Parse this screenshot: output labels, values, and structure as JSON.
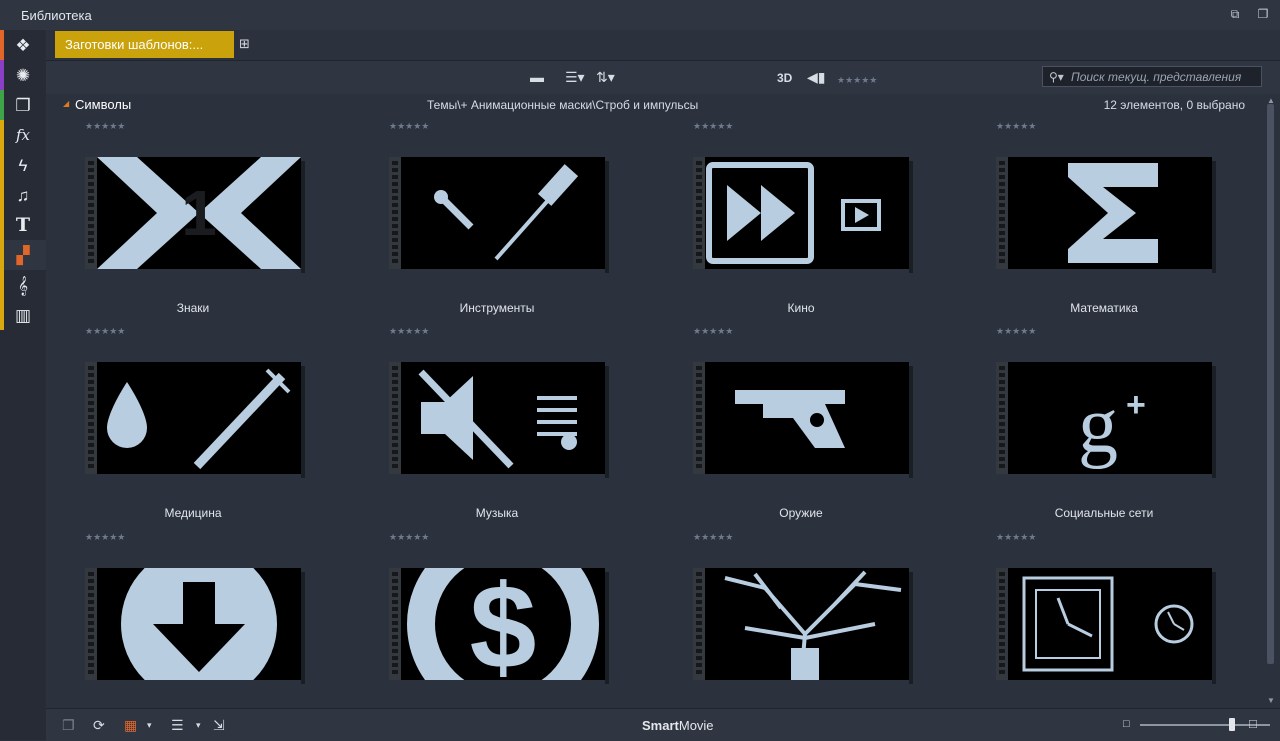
{
  "window": {
    "title": "Библиотека"
  },
  "sidebar": {
    "items": [
      {
        "name": "media-layers-icon",
        "glyph": "❖",
        "color": "#e0662a"
      },
      {
        "name": "film-reel-icon",
        "glyph": "✺",
        "color": "#8b3fc7"
      },
      {
        "name": "photo-stack-icon",
        "glyph": "❐",
        "color": "#3fa447"
      },
      {
        "name": "fx-icon",
        "glyph": "fx",
        "color": "#d9a80f"
      },
      {
        "name": "lightning-icon",
        "glyph": "ϟ",
        "color": "#d9a80f"
      },
      {
        "name": "music-note-icon",
        "glyph": "♫",
        "color": "#d9a80f"
      },
      {
        "name": "title-t-icon",
        "glyph": "T",
        "color": "#d9a80f"
      },
      {
        "name": "template-blocks-icon",
        "glyph": "▞",
        "color": "#d9a80f"
      },
      {
        "name": "treble-clef-icon",
        "glyph": "𝄞",
        "color": "#d9a80f"
      },
      {
        "name": "piano-keys-icon",
        "glyph": "▥",
        "color": "#d9a80f"
      }
    ]
  },
  "tabs": {
    "active_label": "Заготовки шаблонов:..."
  },
  "toolbar": {
    "mode_3d": "3D",
    "search_placeholder": "Поиск текущ. представления"
  },
  "pathbar": {
    "folder": "Символы",
    "path": "Темы\\+ Анимационные маски\\Строб и импульсы",
    "count": "12 элементов, 0 выбрано"
  },
  "items": [
    {
      "label": "Знаки",
      "art": "x1"
    },
    {
      "label": "Инструменты",
      "art": "tools"
    },
    {
      "label": "Кино",
      "art": "cinema"
    },
    {
      "label": "Математика",
      "art": "sigma"
    },
    {
      "label": "Медицина",
      "art": "medicine"
    },
    {
      "label": "Музыка",
      "art": "music"
    },
    {
      "label": "Оружие",
      "art": "gun"
    },
    {
      "label": "Социальные сети",
      "art": "gplus"
    },
    {
      "label": "",
      "art": "download"
    },
    {
      "label": "",
      "art": "dollar"
    },
    {
      "label": "",
      "art": "tree"
    },
    {
      "label": "",
      "art": "clock"
    }
  ],
  "footer": {
    "brand_bold": "Smart",
    "brand_rest": "Movie",
    "zoom": 0.72
  }
}
